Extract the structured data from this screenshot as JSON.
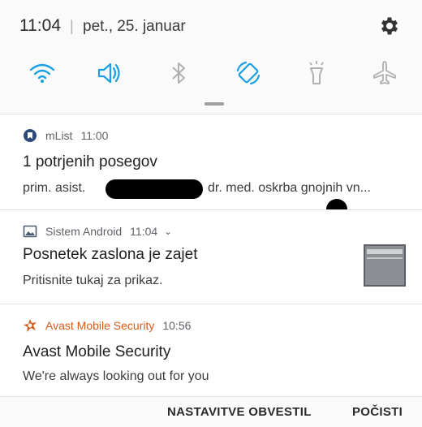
{
  "status": {
    "time": "11:04",
    "separator": "|",
    "date": "pet., 25. januar"
  },
  "quick_toggles": [
    {
      "name": "wifi-icon",
      "active": true
    },
    {
      "name": "sound-icon",
      "active": true
    },
    {
      "name": "bluetooth-icon",
      "active": false
    },
    {
      "name": "auto-rotate-icon",
      "active": true
    },
    {
      "name": "flashlight-icon",
      "active": false
    },
    {
      "name": "airplane-mode-icon",
      "active": false
    }
  ],
  "colors": {
    "accent": "#1aa0e2",
    "inactive": "#b0b0b0",
    "avast": "#d45b1a"
  },
  "notifications": {
    "mlist": {
      "app": "mList",
      "time": "11:00",
      "title": "1 potrjenih posegov",
      "text_before": "prim. asist.",
      "text_after": "dr. med. oskrba gnojnih vn..."
    },
    "sistem": {
      "app": "Sistem Android",
      "time": "11:04",
      "chevron": "⌄",
      "title": "Posnetek zaslona je zajet",
      "text": "Pritisnite tukaj za prikaz."
    },
    "avast": {
      "app": "Avast Mobile Security",
      "time": "10:56",
      "title": "Avast Mobile Security",
      "text": "We're always looking out for you"
    }
  },
  "actions": {
    "settings": "NASTAVITVE OBVESTIL",
    "clear": "POČISTI"
  }
}
